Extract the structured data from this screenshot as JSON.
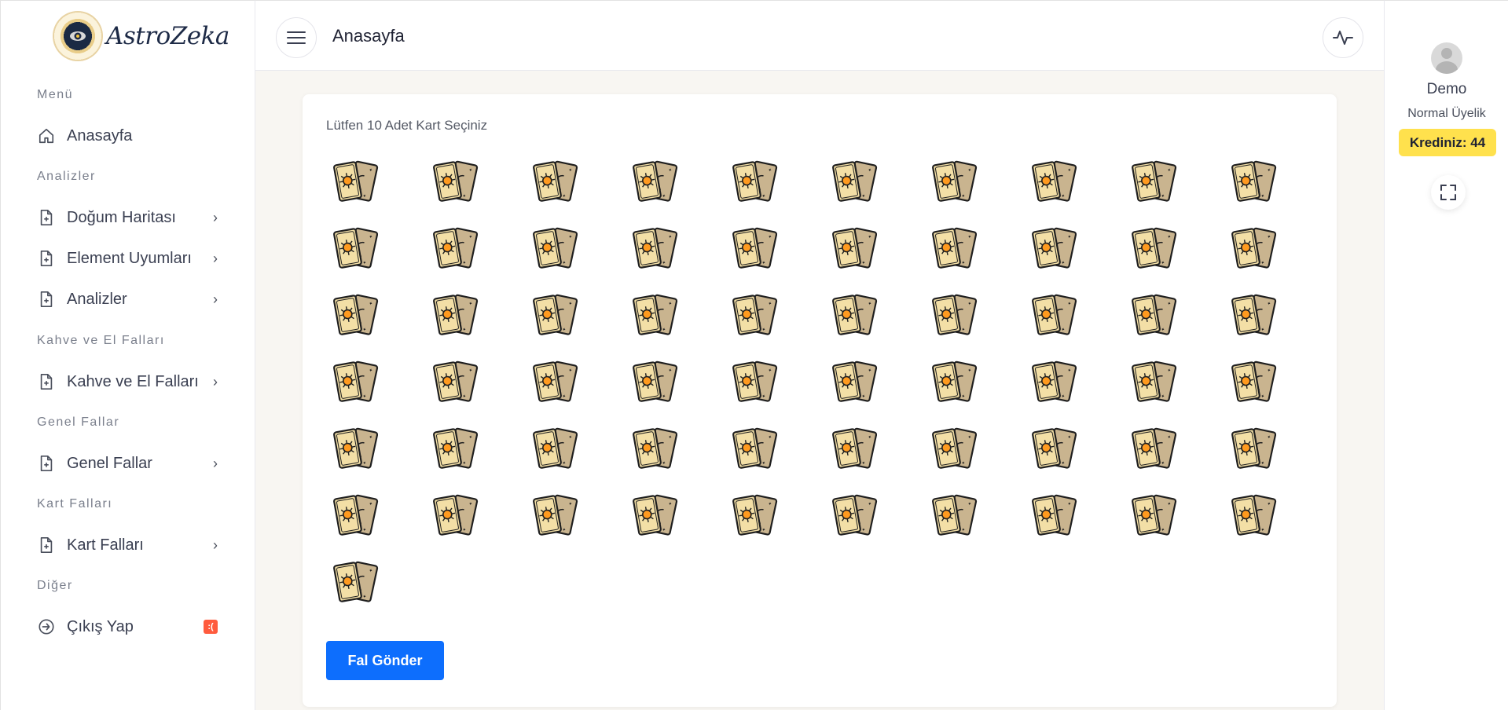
{
  "brand": {
    "name": "AstroZeka"
  },
  "header": {
    "title": "Anasayfa"
  },
  "sidebar": {
    "sections": [
      {
        "title": "Menü",
        "items": [
          {
            "label": "Anasayfa",
            "icon": "home-icon"
          }
        ]
      },
      {
        "title": "Analizler",
        "items": [
          {
            "label": "Doğum Haritası",
            "icon": "document-icon"
          },
          {
            "label": "Element Uyumları",
            "icon": "document-icon"
          },
          {
            "label": "Analizler",
            "icon": "document-icon"
          }
        ]
      },
      {
        "title": "Kahve ve El Falları",
        "items": [
          {
            "label": "Kahve ve El Falları",
            "icon": "document-icon"
          }
        ]
      },
      {
        "title": "Genel Fallar",
        "items": [
          {
            "label": "Genel Fallar",
            "icon": "document-icon"
          }
        ]
      },
      {
        "title": "Kart Falları",
        "items": [
          {
            "label": "Kart Falları",
            "icon": "document-icon"
          }
        ]
      },
      {
        "title": "Diğer",
        "items": [
          {
            "label": "Çıkış Yap",
            "icon": "logout-icon",
            "badge": ":("
          }
        ]
      }
    ]
  },
  "user": {
    "name": "Demo",
    "plan": "Normal Üyelik",
    "credit": "Krediniz: 44"
  },
  "main": {
    "prompt": "Lütfen 10 Adet Kart Seçiniz",
    "card_count": 61,
    "submit_label": "Fal Gönder"
  },
  "colors": {
    "accent": "#0d6efd",
    "credit_bg": "#ffe14d",
    "badge": "#ff5b3d"
  }
}
